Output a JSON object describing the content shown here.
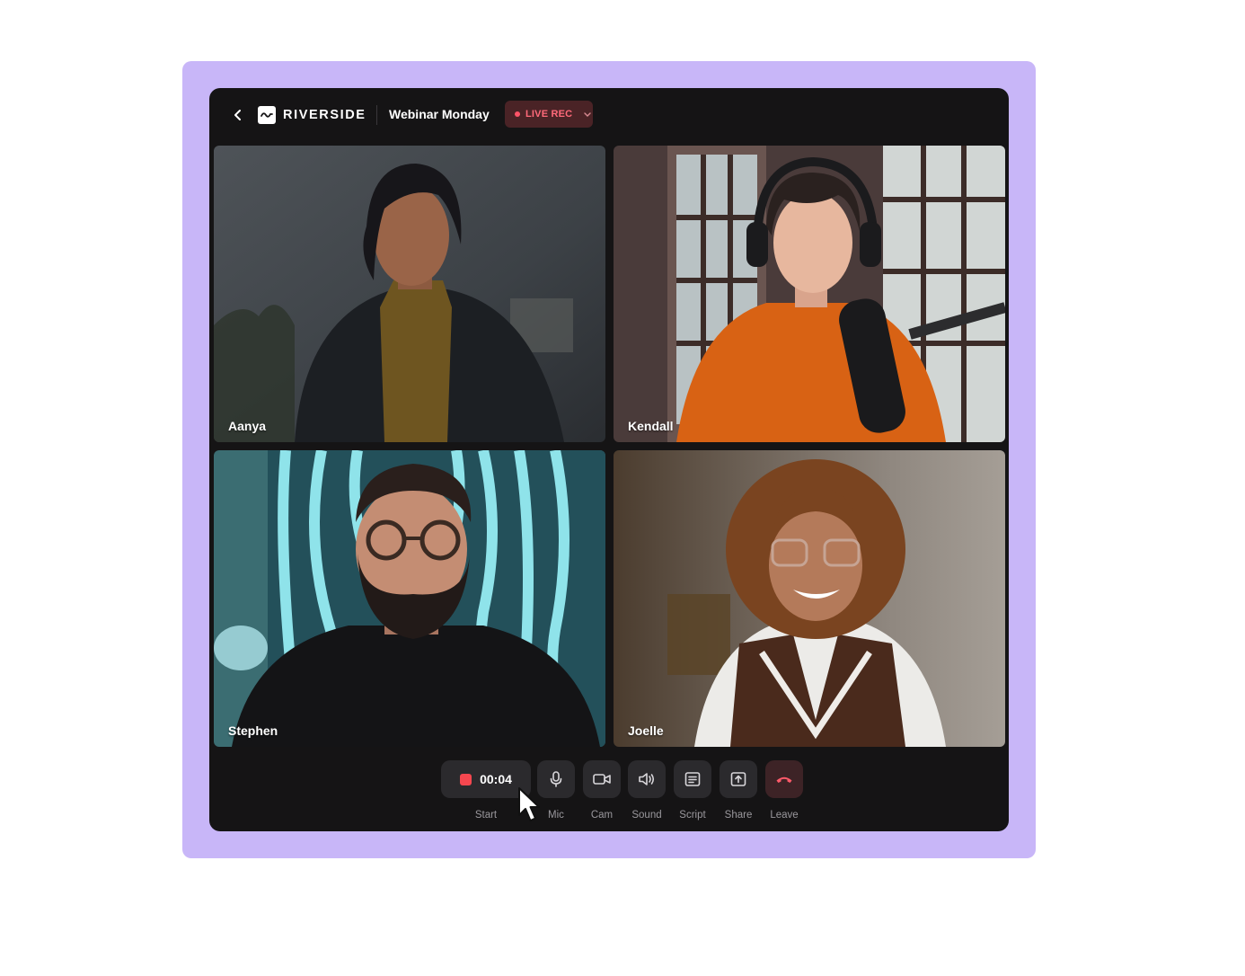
{
  "header": {
    "brand": "RIVERSIDE",
    "session_title": "Webinar Monday",
    "live_badge": "LIVE REC"
  },
  "participants": [
    {
      "name": "Aanya"
    },
    {
      "name": "Kendall"
    },
    {
      "name": "Stephen"
    },
    {
      "name": "Joelle"
    }
  ],
  "controls": {
    "timer": "00:04",
    "start_label": "Start",
    "mic_label": "Mic",
    "cam_label": "Cam",
    "sound_label": "Sound",
    "script_label": "Script",
    "share_label": "Share",
    "leave_label": "Leave"
  },
  "icons": [
    "back-arrow-icon",
    "riverside-logo-icon",
    "chevron-down-icon",
    "record-icon",
    "mic-icon",
    "camera-icon",
    "speaker-icon",
    "script-icon",
    "share-screen-icon",
    "phone-hangup-icon",
    "mouse-cursor-icon"
  ],
  "colors": {
    "frame": "#c8b6f8",
    "app_background": "#151415",
    "record_red": "#f5474f",
    "live_text": "#ff6a7a",
    "leave_red": "#ff5a6a"
  }
}
